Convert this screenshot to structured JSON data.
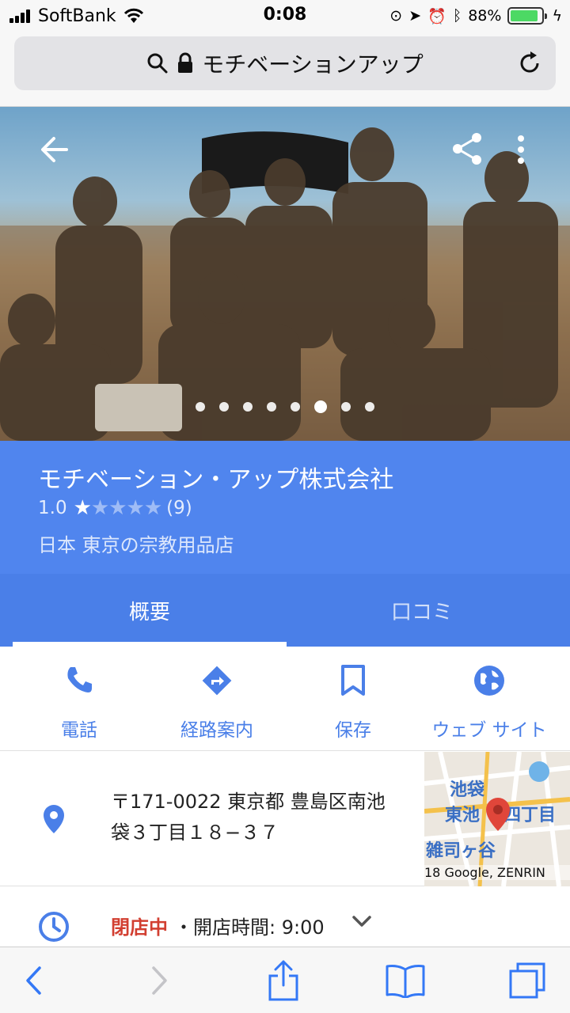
{
  "status_bar": {
    "carrier": "SoftBank",
    "time": "0:08",
    "battery_percent": "88%",
    "battery_level": 0.88,
    "icons": [
      "signal-icon",
      "wifi-icon",
      "orientation-lock-icon",
      "location-icon",
      "alarm-icon",
      "bluetooth-icon",
      "battery-icon",
      "charging-icon"
    ]
  },
  "url_bar": {
    "title": "モチベーションアップ",
    "icons": [
      "search-icon",
      "lock-icon",
      "reload-icon"
    ]
  },
  "hero": {
    "icons": [
      "back-arrow-icon",
      "share-icon",
      "more-vert-icon"
    ],
    "dot_count": 8,
    "active_dot": 6
  },
  "place": {
    "name": "モチベーション・アップ株式会社",
    "rating": "1.0",
    "rating_value": 1,
    "rating_max": 5,
    "review_count": "(9)",
    "category": "日本 東京の宗教用品店",
    "accent_color": "#5085ee"
  },
  "tabs": [
    {
      "label": "概要",
      "active": true
    },
    {
      "label": "口コミ",
      "active": false
    }
  ],
  "actions": [
    {
      "label": "電話",
      "icon": "phone-icon"
    },
    {
      "label": "経路案内",
      "icon": "directions-icon"
    },
    {
      "label": "保存",
      "icon": "bookmark-icon"
    },
    {
      "label": "ウェブ サイト",
      "icon": "globe-icon"
    }
  ],
  "address": {
    "line1": "〒171-0022 東京都 豊島区南池",
    "line2": "袋３丁目１８−３７",
    "icon": "location-pin-icon"
  },
  "map": {
    "labels": [
      "池袋",
      "東池",
      "四丁目",
      "雑司ヶ谷"
    ],
    "credit": "18 Google, ZENRIN"
  },
  "hours": {
    "status": "閉店中",
    "separator": "・",
    "open_time": "開店時間: 9:00",
    "icon": "clock-icon"
  },
  "toolbar": {
    "icons": [
      "back-icon",
      "forward-icon",
      "share-icon",
      "bookmarks-icon",
      "tabs-icon"
    ]
  }
}
